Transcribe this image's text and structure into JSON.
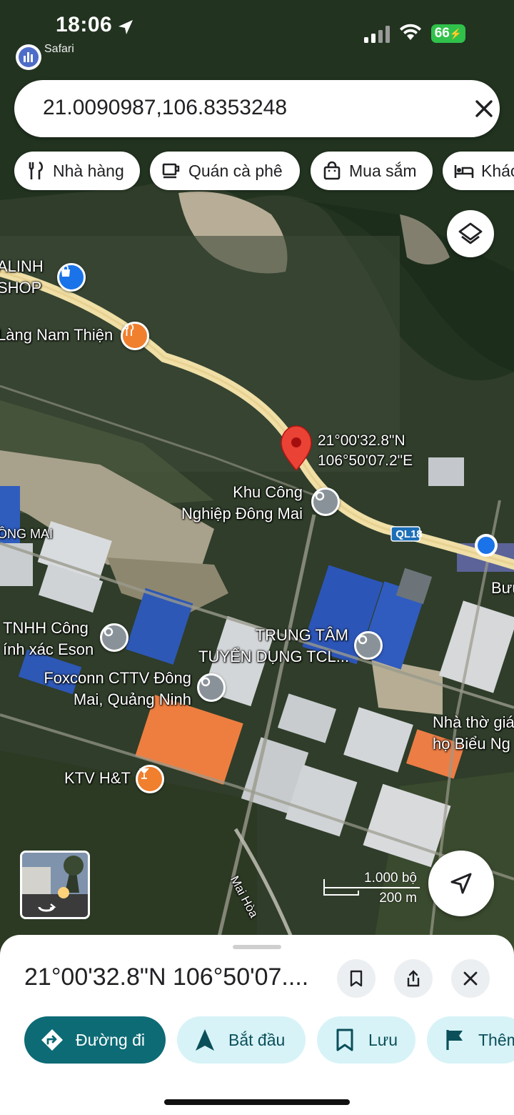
{
  "status_bar": {
    "time": "18:06",
    "back_app": "Safari",
    "battery": "66"
  },
  "search": {
    "query": "21.0090987,106.8353248",
    "clear_icon": "close-icon"
  },
  "chips": [
    {
      "label": "Nhà hàng",
      "icon": "restaurant-icon"
    },
    {
      "label": "Quán cà phê",
      "icon": "cafe-icon"
    },
    {
      "label": "Mua sắm",
      "icon": "shopping-bag-icon"
    },
    {
      "label": "Khác",
      "icon": "hotel-icon"
    }
  ],
  "map": {
    "pin_label_line1": "21°00'32.8\"N",
    "pin_label_line2": "106°50'07.2\"E",
    "road_badge": "QL18",
    "places": [
      {
        "label_lines": [
          "ALINH",
          "SHOP"
        ],
        "icon": "shopping-bag-icon"
      },
      {
        "label_lines": [
          "Làng Nam Thiện"
        ],
        "icon": "restaurant-icon"
      },
      {
        "label_lines": [
          "Khu Công",
          "Nghiệp Đông Mai"
        ],
        "icon": "location-icon"
      },
      {
        "label_lines": [
          "ÔNG MAI"
        ],
        "icon": ""
      },
      {
        "label_lines": [
          "TNHH Công",
          "ính xác Eson"
        ],
        "icon": "location-icon"
      },
      {
        "label_lines": [
          "TRUNG TÂM",
          "TUYỂN DỤNG TCL..."
        ],
        "icon": "location-icon"
      },
      {
        "label_lines": [
          "Foxconn CTTV Đông",
          "Mai, Quảng Ninh"
        ],
        "icon": "location-icon"
      },
      {
        "label_lines": [
          "Nhà thờ giá",
          "họ Biểu Ng"
        ],
        "icon": ""
      },
      {
        "label_lines": [
          "KTV H&T"
        ],
        "icon": "bar-icon"
      },
      {
        "label_lines": [
          "Bưu"
        ],
        "icon": ""
      },
      {
        "label_lines": [
          "Mai Hòa"
        ],
        "icon": ""
      }
    ],
    "scale_line1": "1.000 bộ",
    "scale_line2": "200 m"
  },
  "sheet": {
    "title": "21°00'32.8\"N 106°50'07....",
    "actions": [
      {
        "label": "Đường đi",
        "icon": "directions-icon"
      },
      {
        "label": "Bắt đầu",
        "icon": "navigation-arrow-icon"
      },
      {
        "label": "Lưu",
        "icon": "bookmark-icon"
      },
      {
        "label": "Thêm",
        "icon": "flag-icon"
      }
    ]
  },
  "colors": {
    "accent": "#0d6b75",
    "accent_light": "#d7f3f7",
    "pin": "#ea4335",
    "road": "#e8d49a",
    "poi_grey": "#8a9299",
    "poi_orange": "#f07f2e",
    "poi_blue": "#1a73e8"
  }
}
